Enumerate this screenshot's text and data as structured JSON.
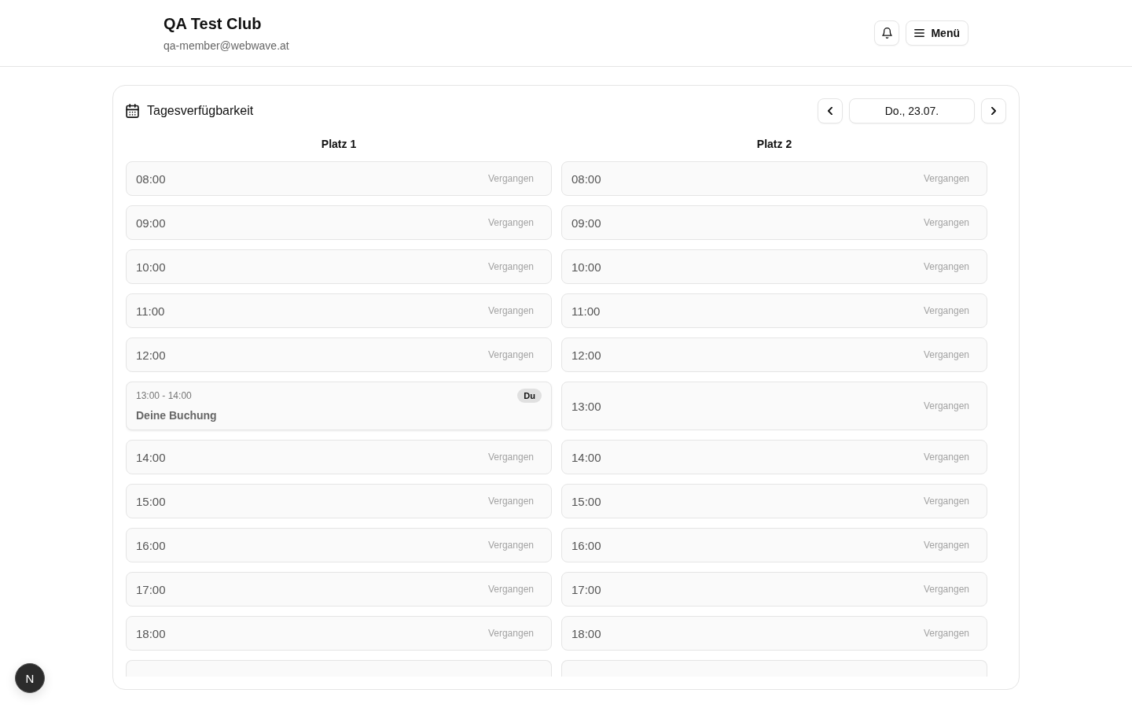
{
  "header": {
    "club_name": "QA Test Club",
    "user_email": "qa-member@webwave.at",
    "menu_button": {
      "label": "Menü"
    }
  },
  "availability": {
    "title": "Tagesverfügbarkeit",
    "date": "Do., 23.07.",
    "courts": [
      {
        "name": "Platz 1",
        "slots": [
          {
            "kind": "past",
            "time": "08:00",
            "status": "Vergangen"
          },
          {
            "kind": "past",
            "time": "09:00",
            "status": "Vergangen"
          },
          {
            "kind": "past",
            "time": "10:00",
            "status": "Vergangen"
          },
          {
            "kind": "past",
            "time": "11:00",
            "status": "Vergangen"
          },
          {
            "kind": "past",
            "time": "12:00",
            "status": "Vergangen"
          },
          {
            "kind": "booking",
            "time_range": "13:00 - 14:00",
            "title": "Deine Buchung",
            "badge": "Du"
          },
          {
            "kind": "past",
            "time": "14:00",
            "status": "Vergangen"
          },
          {
            "kind": "past",
            "time": "15:00",
            "status": "Vergangen"
          },
          {
            "kind": "past",
            "time": "16:00",
            "status": "Vergangen"
          },
          {
            "kind": "past",
            "time": "17:00",
            "status": "Vergangen"
          },
          {
            "kind": "past",
            "time": "18:00",
            "status": "Vergangen"
          },
          {
            "kind": "cut"
          }
        ]
      },
      {
        "name": "Platz 2",
        "slots": [
          {
            "kind": "past",
            "time": "08:00",
            "status": "Vergangen"
          },
          {
            "kind": "past",
            "time": "09:00",
            "status": "Vergangen"
          },
          {
            "kind": "past",
            "time": "10:00",
            "status": "Vergangen"
          },
          {
            "kind": "past",
            "time": "11:00",
            "status": "Vergangen"
          },
          {
            "kind": "past",
            "time": "12:00",
            "status": "Vergangen"
          },
          {
            "kind": "past",
            "time": "13:00",
            "status": "Vergangen"
          },
          {
            "kind": "past",
            "time": "14:00",
            "status": "Vergangen"
          },
          {
            "kind": "past",
            "time": "15:00",
            "status": "Vergangen"
          },
          {
            "kind": "past",
            "time": "16:00",
            "status": "Vergangen"
          },
          {
            "kind": "past",
            "time": "17:00",
            "status": "Vergangen"
          },
          {
            "kind": "past",
            "time": "18:00",
            "status": "Vergangen"
          },
          {
            "kind": "cut"
          }
        ]
      }
    ]
  },
  "dev_badge": {
    "label": "N"
  }
}
